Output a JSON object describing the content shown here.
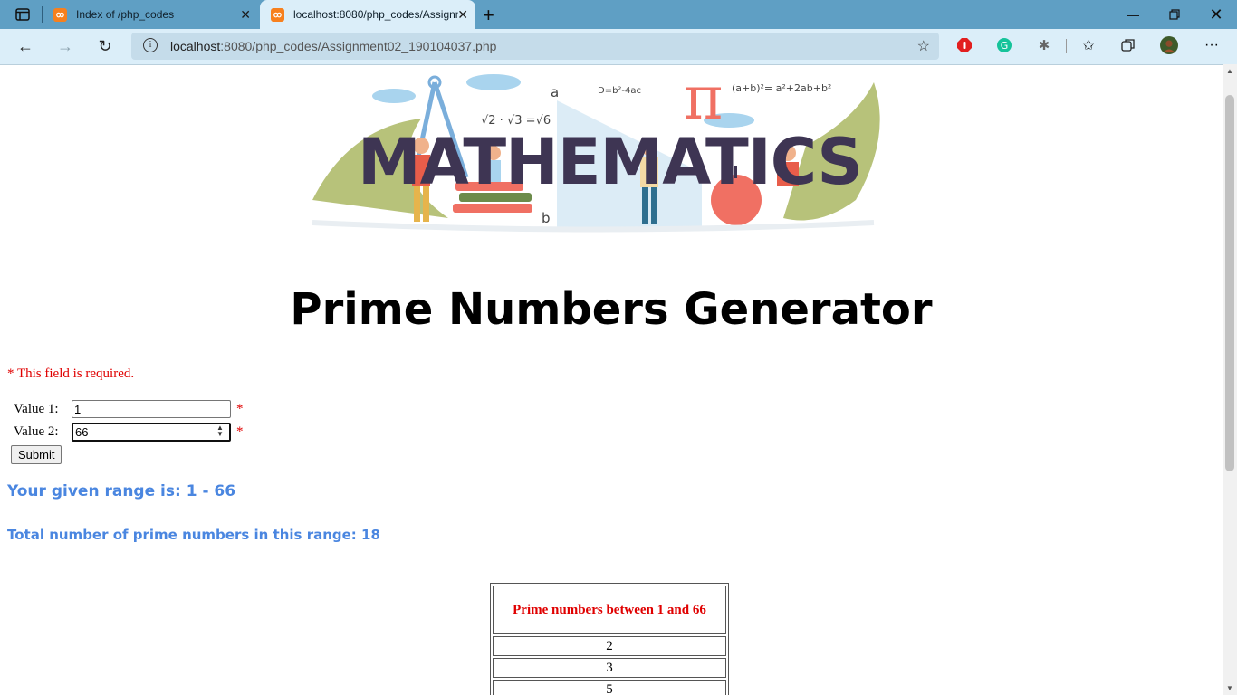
{
  "browser": {
    "tabs": [
      {
        "title": "Index of /php_codes",
        "active": false
      },
      {
        "title": "localhost:8080/php_codes/Assignment02_190104037.php",
        "active": true
      }
    ],
    "address": {
      "url_host": "localhost",
      "url_rest": ":8080/php_codes/Assignment02_190104037.php"
    },
    "colors": {
      "tabbar": "#5f9fc4",
      "toolbar": "#dbeef9"
    }
  },
  "page": {
    "banner": {
      "word": "MATHEMATICS",
      "formulas": [
        "a",
        "D=b²-4ac",
        "π",
        "(a+b)²= a²+2ab+b²",
        "√2 · √3 =√6",
        "b"
      ]
    },
    "title": "Prime Numbers Generator",
    "required_note": "* This field is required.",
    "form": {
      "value1_label": "Value 1:",
      "value1": "1",
      "value2_label": "Value 2:",
      "value2": "66",
      "star": "*",
      "submit_label": "Submit"
    },
    "range_text": "Your given range is: 1 - 66",
    "total_text": "Total number of prime numbers in this range: 18",
    "table": {
      "header": "Prime numbers between 1 and 66",
      "rows": [
        "2",
        "3",
        "5"
      ]
    },
    "colors": {
      "required": "#e00000",
      "info": "#4a86e0"
    }
  }
}
